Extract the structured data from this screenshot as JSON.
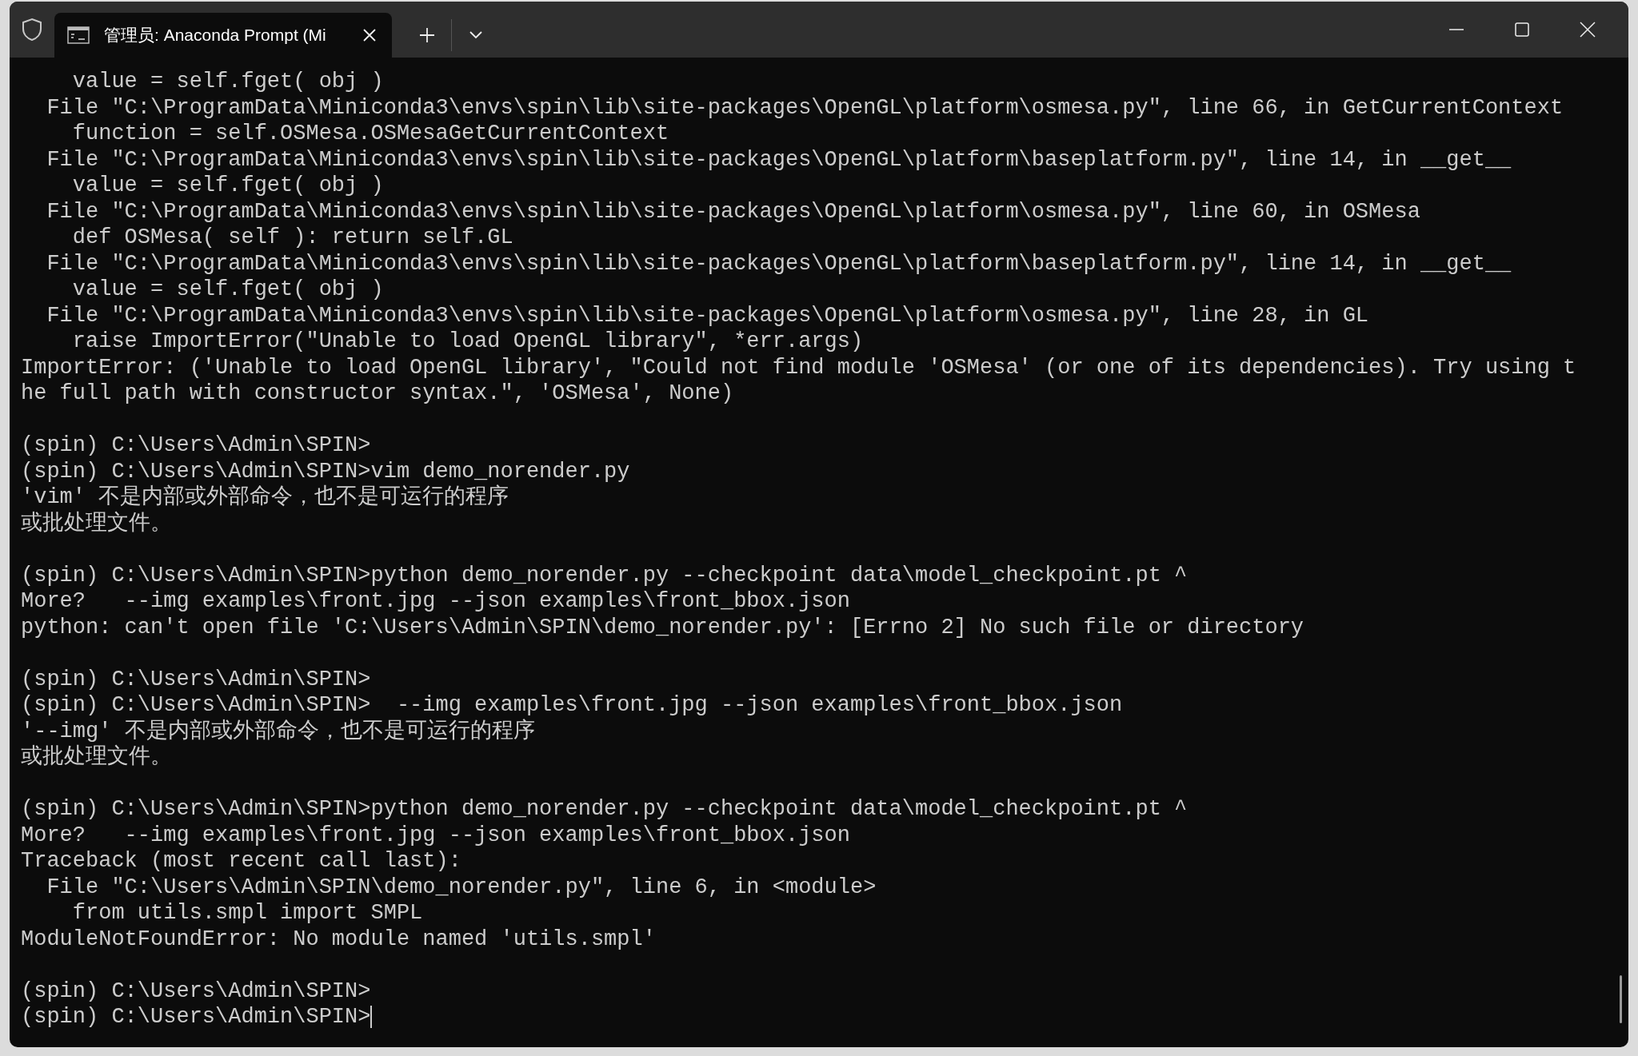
{
  "tab": {
    "title": "管理员: Anaconda Prompt (Mi"
  },
  "blocks": [
    [
      "    value = self.fget( obj )",
      "  File \"C:\\ProgramData\\Miniconda3\\envs\\spin\\lib\\site-packages\\OpenGL\\platform\\osmesa.py\", line 66, in GetCurrentContext",
      "    function = self.OSMesa.OSMesaGetCurrentContext",
      "  File \"C:\\ProgramData\\Miniconda3\\envs\\spin\\lib\\site-packages\\OpenGL\\platform\\baseplatform.py\", line 14, in __get__",
      "    value = self.fget( obj )",
      "  File \"C:\\ProgramData\\Miniconda3\\envs\\spin\\lib\\site-packages\\OpenGL\\platform\\osmesa.py\", line 60, in OSMesa",
      "    def OSMesa( self ): return self.GL",
      "  File \"C:\\ProgramData\\Miniconda3\\envs\\spin\\lib\\site-packages\\OpenGL\\platform\\baseplatform.py\", line 14, in __get__",
      "    value = self.fget( obj )",
      "  File \"C:\\ProgramData\\Miniconda3\\envs\\spin\\lib\\site-packages\\OpenGL\\platform\\osmesa.py\", line 28, in GL",
      "    raise ImportError(\"Unable to load OpenGL library\", *err.args)",
      "ImportError: ('Unable to load OpenGL library', \"Could not find module 'OSMesa' (or one of its dependencies). Try using t",
      "he full path with constructor syntax.\", 'OSMesa', None)"
    ],
    [
      "(spin) C:\\Users\\Admin\\SPIN>",
      "(spin) C:\\Users\\Admin\\SPIN>vim demo_norender.py",
      "'vim' 不是内部或外部命令，也不是可运行的程序",
      "或批处理文件。"
    ],
    [
      "(spin) C:\\Users\\Admin\\SPIN>python demo_norender.py --checkpoint data\\model_checkpoint.pt ^",
      "More?   --img examples\\front.jpg --json examples\\front_bbox.json",
      "python: can't open file 'C:\\Users\\Admin\\SPIN\\demo_norender.py': [Errno 2] No such file or directory"
    ],
    [
      "(spin) C:\\Users\\Admin\\SPIN>",
      "(spin) C:\\Users\\Admin\\SPIN>  --img examples\\front.jpg --json examples\\front_bbox.json",
      "'--img' 不是内部或外部命令，也不是可运行的程序",
      "或批处理文件。"
    ],
    [
      "(spin) C:\\Users\\Admin\\SPIN>python demo_norender.py --checkpoint data\\model_checkpoint.pt ^",
      "More?   --img examples\\front.jpg --json examples\\front_bbox.json",
      "Traceback (most recent call last):",
      "  File \"C:\\Users\\Admin\\SPIN\\demo_norender.py\", line 6, in <module>",
      "    from utils.smpl import SMPL",
      "ModuleNotFoundError: No module named 'utils.smpl'"
    ],
    [
      "(spin) C:\\Users\\Admin\\SPIN>",
      "(spin) C:\\Users\\Admin\\SPIN>"
    ]
  ]
}
